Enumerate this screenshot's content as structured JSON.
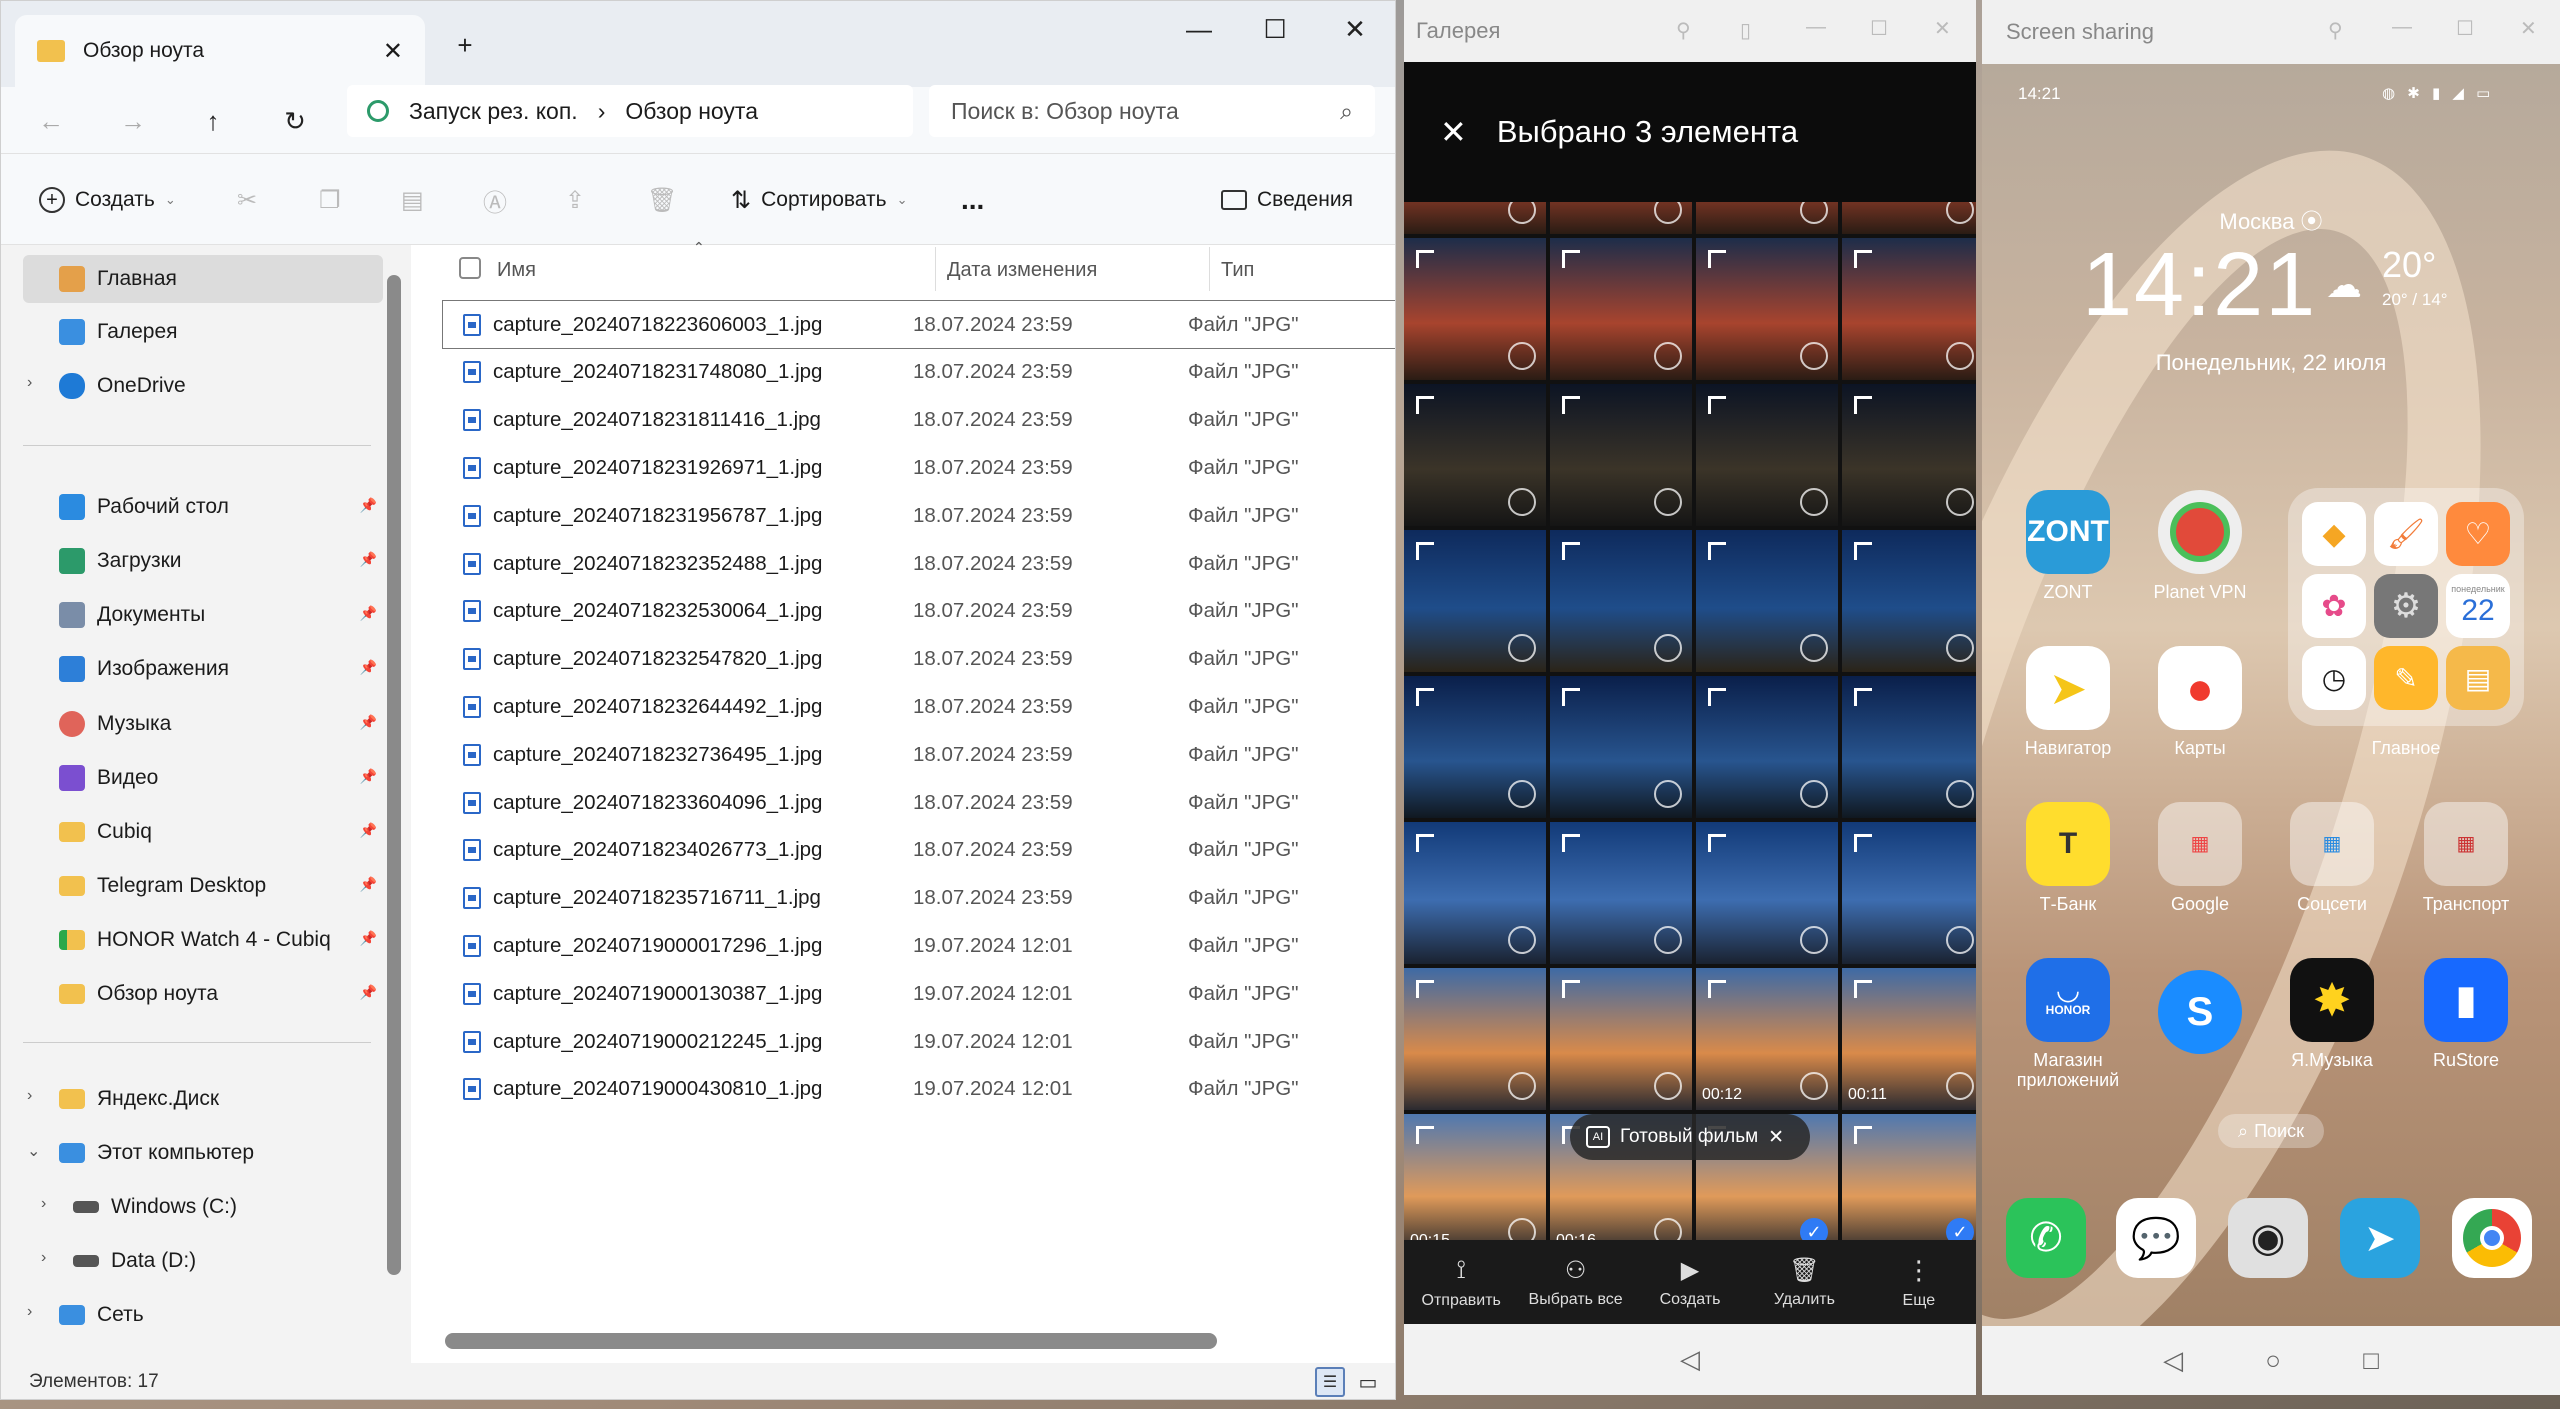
{
  "explorer": {
    "tab_title": "Обзор ноута",
    "breadcrumb": [
      "Запуск рез. коп.",
      "Обзор ноута"
    ],
    "search_placeholder": "Поиск в: Обзор ноута",
    "toolbar": {
      "create": "Создать",
      "sort": "Сортировать",
      "details": "Сведения",
      "more": "..."
    },
    "sidebar": [
      {
        "label": "Главная",
        "icon": "home-icon",
        "color": "#e4a04a"
      },
      {
        "label": "Галерея",
        "icon": "gallery-icon",
        "color": "#3a8fe0"
      },
      {
        "label": "OneDrive",
        "icon": "cloud-icon",
        "color": "#1e7ad6"
      },
      {
        "label": "Рабочий стол",
        "icon": "desktop-icon",
        "color": "#2b8be0"
      },
      {
        "label": "Загрузки",
        "icon": "download-icon",
        "color": "#2c9a6a"
      },
      {
        "label": "Документы",
        "icon": "documents-icon",
        "color": "#7a8da8"
      },
      {
        "label": "Изображения",
        "icon": "pictures-icon",
        "color": "#2d7fd8"
      },
      {
        "label": "Музыка",
        "icon": "music-icon",
        "color": "#e0645a"
      },
      {
        "label": "Видео",
        "icon": "video-icon",
        "color": "#7b4fd0"
      },
      {
        "label": "Cubiq",
        "icon": "folder-icon",
        "color": "#f2c14e"
      },
      {
        "label": "Telegram Desktop",
        "icon": "folder-icon",
        "color": "#f2c14e"
      },
      {
        "label": "HONOR Watch 4 - Cubiq",
        "icon": "folder-sync-icon",
        "color": "#f2c14e"
      },
      {
        "label": "Обзор ноута",
        "icon": "folder-icon",
        "color": "#f2c14e"
      },
      {
        "label": "Яндекс.Диск",
        "icon": "yandex-disk-icon",
        "color": "#f2c14e"
      },
      {
        "label": "Этот компьютер",
        "icon": "computer-icon",
        "color": "#3a8fe0"
      },
      {
        "label": "Windows (C:)",
        "icon": "drive-icon",
        "color": "#555555"
      },
      {
        "label": "Data (D:)",
        "icon": "drive-icon",
        "color": "#555555"
      },
      {
        "label": "Сеть",
        "icon": "network-icon",
        "color": "#3a8fe0"
      }
    ],
    "columns": {
      "name": "Имя",
      "date": "Дата изменения",
      "type": "Тип"
    },
    "files": [
      {
        "name": "capture_20240718223606003_1.jpg",
        "date": "18.07.2024 23:59",
        "type": "Файл \"JPG\""
      },
      {
        "name": "capture_20240718231748080_1.jpg",
        "date": "18.07.2024 23:59",
        "type": "Файл \"JPG\""
      },
      {
        "name": "capture_20240718231811416_1.jpg",
        "date": "18.07.2024 23:59",
        "type": "Файл \"JPG\""
      },
      {
        "name": "capture_20240718231926971_1.jpg",
        "date": "18.07.2024 23:59",
        "type": "Файл \"JPG\""
      },
      {
        "name": "capture_20240718231956787_1.jpg",
        "date": "18.07.2024 23:59",
        "type": "Файл \"JPG\""
      },
      {
        "name": "capture_20240718232352488_1.jpg",
        "date": "18.07.2024 23:59",
        "type": "Файл \"JPG\""
      },
      {
        "name": "capture_20240718232530064_1.jpg",
        "date": "18.07.2024 23:59",
        "type": "Файл \"JPG\""
      },
      {
        "name": "capture_20240718232547820_1.jpg",
        "date": "18.07.2024 23:59",
        "type": "Файл \"JPG\""
      },
      {
        "name": "capture_20240718232644492_1.jpg",
        "date": "18.07.2024 23:59",
        "type": "Файл \"JPG\""
      },
      {
        "name": "capture_20240718232736495_1.jpg",
        "date": "18.07.2024 23:59",
        "type": "Файл \"JPG\""
      },
      {
        "name": "capture_20240718233604096_1.jpg",
        "date": "18.07.2024 23:59",
        "type": "Файл \"JPG\""
      },
      {
        "name": "capture_20240718234026773_1.jpg",
        "date": "18.07.2024 23:59",
        "type": "Файл \"JPG\""
      },
      {
        "name": "capture_20240718235716711_1.jpg",
        "date": "18.07.2024 23:59",
        "type": "Файл \"JPG\""
      },
      {
        "name": "capture_20240719000017296_1.jpg",
        "date": "19.07.2024 12:01",
        "type": "Файл \"JPG\""
      },
      {
        "name": "capture_20240719000130387_1.jpg",
        "date": "19.07.2024 12:01",
        "type": "Файл \"JPG\""
      },
      {
        "name": "capture_20240719000212245_1.jpg",
        "date": "19.07.2024 12:01",
        "type": "Файл \"JPG\""
      },
      {
        "name": "capture_20240719000430810_1.jpg",
        "date": "19.07.2024 12:01",
        "type": "Файл \"JPG\""
      }
    ],
    "status": "Элементов: 17"
  },
  "gallery": {
    "window_title": "Галерея",
    "header": "Выбрано 3 элемента",
    "film_chip": "Готовый фильм",
    "durations": [
      "00:12",
      "00:11",
      "00:15",
      "00:16"
    ],
    "actions": [
      {
        "label": "Отправить",
        "icon": "share-icon"
      },
      {
        "label": "Выбрать все",
        "icon": "select-all-icon"
      },
      {
        "label": "Создать",
        "icon": "create-icon"
      },
      {
        "label": "Удалить",
        "icon": "delete-icon"
      },
      {
        "label": "Еще",
        "icon": "more-icon"
      }
    ]
  },
  "phone": {
    "window_title": "Screen sharing",
    "status_time": "14:21",
    "city": "Москва",
    "clock": "14:21",
    "temp": "20°",
    "temp_range": "20° / 14°",
    "date": "Понедельник, 22 июля",
    "apps": [
      {
        "label": "ZONT",
        "color": "#2a9bd8"
      },
      {
        "label": "Planet VPN",
        "color": "#e8e8e8"
      },
      {
        "label": "Навигатор",
        "color": "#ffffff"
      },
      {
        "label": "Карты",
        "color": "#ffffff"
      },
      {
        "label": "Главное",
        "color": "#ffffff"
      },
      {
        "label": "Т-Банк",
        "color": "#ffdd2d"
      },
      {
        "label": "Google",
        "color": "#ffffff"
      },
      {
        "label": "Соцсети",
        "color": "#ffffff"
      },
      {
        "label": "Транспорт",
        "color": "#ffffff"
      },
      {
        "label": "Магазин приложений",
        "color": "#1f6fe8"
      },
      {
        "label": "Shazam",
        "color": "#1a8cff"
      },
      {
        "label": "Я.Музыка",
        "color": "#111111"
      },
      {
        "label": "RuStore",
        "color": "#1769ff"
      }
    ],
    "folder_day": "22",
    "folder_weekday": "понедельник",
    "zont_text": "ZONT",
    "search_label": "Поиск",
    "honor_text": "HONOR"
  }
}
